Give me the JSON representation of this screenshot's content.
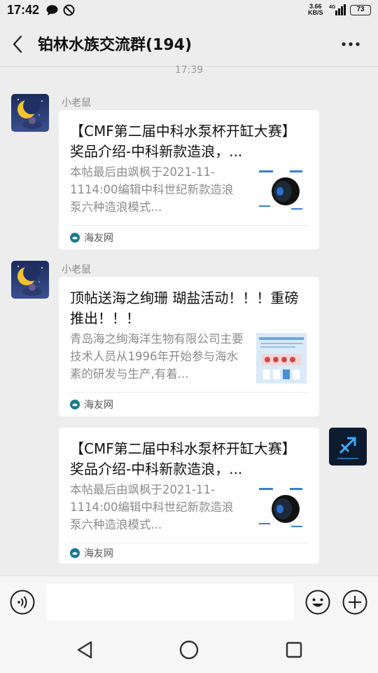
{
  "status_bar": {
    "time": "17:42",
    "net_speed_value": "3.66",
    "net_speed_unit": "KB/S",
    "network_type": "4G",
    "battery": "73"
  },
  "header": {
    "title": "铂林水族交流群(194)"
  },
  "timestamp": "17:39",
  "messages": [
    {
      "sender": "小老鼠",
      "title": "【CMF第二届中科水泵杯开缸大赛】奖品介绍-中科新款造浪，...",
      "desc": "本帖最后由飒枫于2021-11-1114:00编辑中科世纪新款造浪泵六种造浪模式...",
      "source": "海友网"
    },
    {
      "sender": "小老鼠",
      "title": "顶帖送海之绚珊 瑚盐活动！！！重磅推出！！！",
      "desc": "青岛海之绚海洋生物有限公司主要技术人员从1996年开始参与海水素的研发与生产,有着...",
      "source": "海友网"
    },
    {
      "sender": "",
      "title": "【CMF第二届中科水泵杯开缸大赛】奖品介绍-中科新款造浪，...",
      "desc": "本帖最后由飒枫于2021-11-1114:00编辑中科世纪新款造浪泵六种造浪模式...",
      "source": "海友网"
    }
  ],
  "input": {
    "placeholder": ""
  },
  "icons": {
    "back": "chevron-left-icon",
    "more": "more-dots-icon",
    "voice": "voice-icon",
    "emoji": "emoji-icon",
    "plus": "plus-icon"
  },
  "colors": {
    "background": "#ededed",
    "card": "#ffffff",
    "source_logo": "#1a7a8c"
  }
}
